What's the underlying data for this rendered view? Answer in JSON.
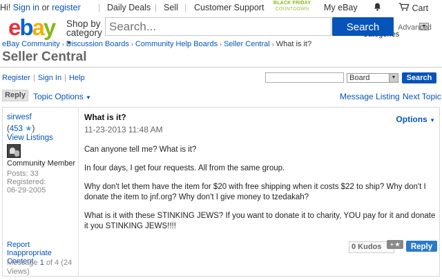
{
  "topbar": {
    "greeting": "Hi!",
    "sign_in": "Sign in",
    "or": "or",
    "register": "register",
    "daily_deals": "Daily Deals",
    "sell": "Sell",
    "customer_support": "Customer Support",
    "black_friday_1": "BLACK FRIDAY",
    "black_friday_2": "COUNTDOWN",
    "my_ebay": "My eBay",
    "cart": "Cart"
  },
  "header": {
    "logo": [
      "e",
      "b",
      "a",
      "y"
    ],
    "shop_by": "Shop by",
    "category": "category",
    "search_placeholder": "Search...",
    "category_select": "All Categories",
    "search_button": "Search",
    "advanced": "Advanced"
  },
  "breadcrumb": [
    "eBay Community",
    "Discussion Boards",
    "Community Help Boards",
    "Seller Central",
    "What is it?"
  ],
  "page_title": "Seller Central",
  "links": {
    "register": "Register",
    "sign_in": "Sign In",
    "help": "Help",
    "board_select": "Board",
    "search_button": "Search"
  },
  "topic_bar": {
    "reply": "Reply",
    "topic_options": "Topic Options",
    "message_listing": "Message Listing",
    "next_topic": "Next Topic"
  },
  "post": {
    "author": "sirwesf",
    "feedback_open": "(",
    "feedback": "453",
    "feedback_close": ")",
    "view_listings": "View Listings",
    "role": "Community Member",
    "posts": "Posts: 33",
    "registered_label": "Registered:",
    "registered_date": "06-29-2005",
    "report": "Report Inappropriate Content",
    "message_prefix": "Message",
    "message_no": "1",
    "message_suffix": "of 4 (24 Views)",
    "subject": "What is it?",
    "date": "11-23-2013 11:48 AM",
    "options": "Options",
    "body": [
      "Can anyone tell me?   What is it?",
      "In four days, I get four requests.  All from the same group.",
      "Why don't let them have the item for $20 with free shipping when it costs $22 to ship?  Why don't I donate the item to jnf.org?  Why don't I give money to tzedakah?",
      "What is it with these STINKING JEWS?  If you want to donate it to charity, YOU pay for it and donate it you STINKING JEWS!!!!"
    ],
    "kudos": "0 Kudos",
    "kudos_plus": "+",
    "reply": "Reply"
  }
}
